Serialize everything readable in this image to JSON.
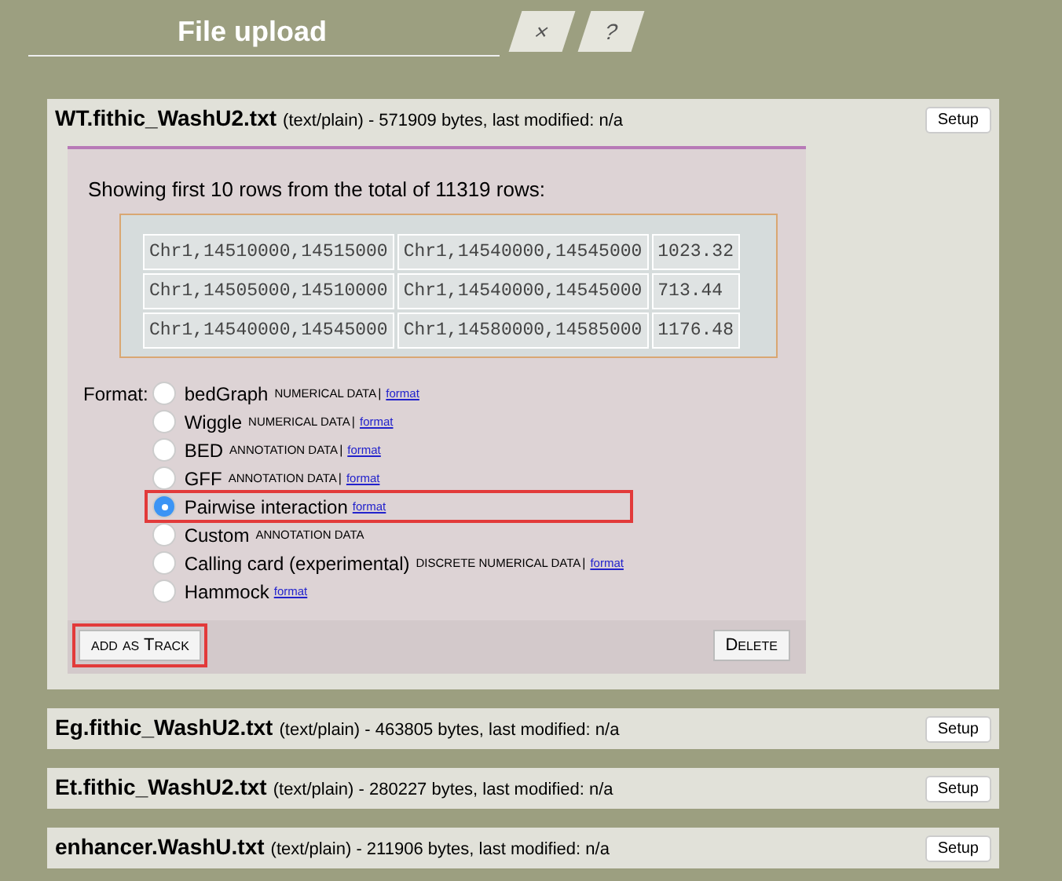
{
  "dialog": {
    "title": "File upload",
    "close": "×",
    "help": "?"
  },
  "files": [
    {
      "name": "WT.fithic_WashU2.txt",
      "info": "(text/plain) - 571909 bytes, last modified: n/a",
      "setup": "Setup",
      "expanded": true
    },
    {
      "name": "Eg.fithic_WashU2.txt",
      "info": "(text/plain) - 463805 bytes, last modified: n/a",
      "setup": "Setup",
      "expanded": false
    },
    {
      "name": "Et.fithic_WashU2.txt",
      "info": "(text/plain) - 280227 bytes, last modified: n/a",
      "setup": "Setup",
      "expanded": false
    },
    {
      "name": "enhancer.WashU.txt",
      "info": "(text/plain) - 211906 bytes, last modified: n/a",
      "setup": "Setup",
      "expanded": false
    }
  ],
  "preview": {
    "caption": "Showing first 10 rows from the total of 11319 rows:",
    "rows": [
      [
        "Chr1,14510000,14515000",
        "Chr1,14540000,14545000",
        "1023.32"
      ],
      [
        "Chr1,14505000,14510000",
        "Chr1,14540000,14545000",
        "713.44"
      ],
      [
        "Chr1,14540000,14545000",
        "Chr1,14580000,14585000",
        "1176.48"
      ]
    ]
  },
  "format": {
    "label": "Format:",
    "options": [
      {
        "name": "bedGraph",
        "category": "NUMERICAL DATA",
        "separator": "|",
        "link": "format",
        "selected": false,
        "highlighted": false
      },
      {
        "name": "Wiggle",
        "category": "NUMERICAL DATA",
        "separator": "|",
        "link": "format",
        "selected": false,
        "highlighted": false
      },
      {
        "name": "BED",
        "category": "ANNOTATION DATA",
        "separator": "|",
        "link": "format",
        "selected": false,
        "highlighted": false
      },
      {
        "name": "GFF",
        "category": "ANNOTATION DATA",
        "separator": "|",
        "link": "format",
        "selected": false,
        "highlighted": false
      },
      {
        "name": "Pairwise interaction",
        "link": "format",
        "selected": true,
        "highlighted": true
      },
      {
        "name": "Custom",
        "category": "ANNOTATION DATA",
        "selected": false,
        "highlighted": false
      },
      {
        "name": "Calling card (experimental)",
        "category": "DISCRETE NUMERICAL DATA",
        "separator": "|",
        "link": "format",
        "selected": false,
        "highlighted": false
      },
      {
        "name": "Hammock",
        "link": "format",
        "selected": false,
        "highlighted": false
      }
    ]
  },
  "actions": {
    "add": {
      "label": "add as Track",
      "highlighted": true
    },
    "delete": "Delete"
  }
}
